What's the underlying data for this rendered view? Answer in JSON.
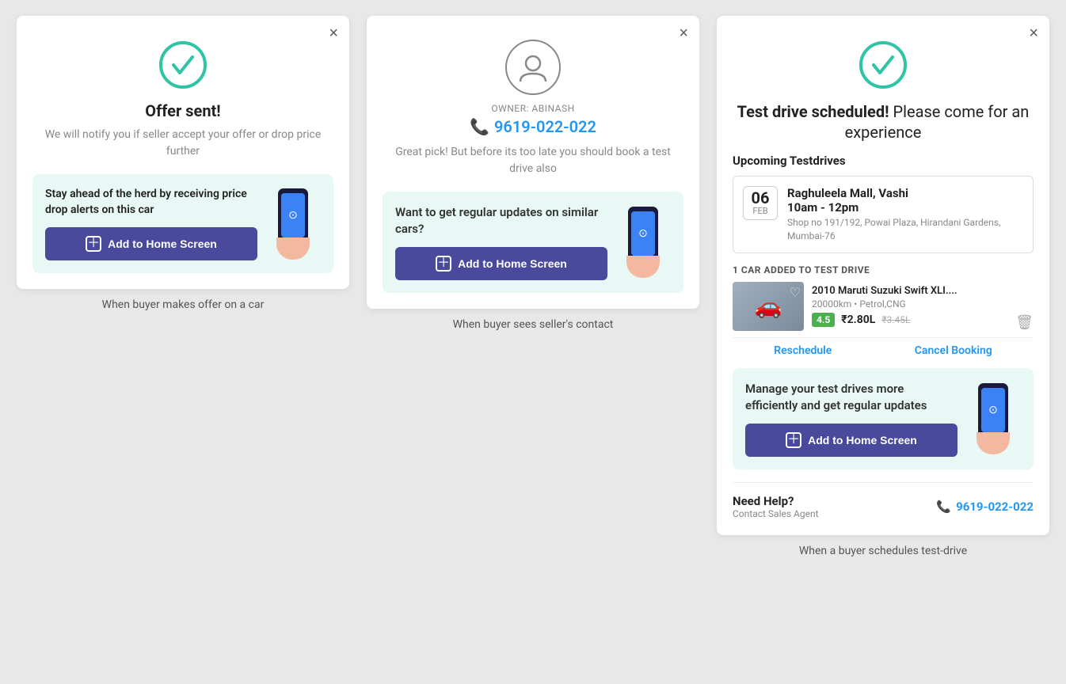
{
  "panel1": {
    "close": "×",
    "title_bold": "Offer sent!",
    "subtitle": "We will notify you if seller accept your offer or drop price further",
    "banner_text": "Stay ahead of the herd by receiving price drop alerts on this car",
    "btn_label": "Add to Home Screen",
    "caption": "When buyer makes offer on a car"
  },
  "panel2": {
    "close": "×",
    "owner_label": "OWNER: ABINASH",
    "owner_phone": "9619-022-022",
    "pick_text": "Great pick! But before its too late you should book a test drive also",
    "banner_text": "Want to get regular updates on similar cars?",
    "btn_label": "Add to Home Screen",
    "caption": "When buyer sees seller's contact"
  },
  "panel3": {
    "close": "×",
    "title_bold": "Test drive scheduled!",
    "title_normal": " Please come for an experience",
    "upcoming_label": "Upcoming Testdrives",
    "date_num": "06",
    "date_month": "FEB",
    "venue_name": "Raghuleela Mall, Vashi",
    "time": "10am - 12pm",
    "address": "Shop no 191/192, Powai Plaza, Hirandani Gardens, Mumbai-76",
    "car_added_label": "1 CAR ADDED TO TEST DRIVE",
    "car_name": "2010 Maruti Suzuki Swift XLI....",
    "car_meta": "20000km • Petrol,CNG",
    "rating": "4.5",
    "price_current": "₹2.80L",
    "price_old": "₹3.45L",
    "reschedule": "Reschedule",
    "cancel": "Cancel Booking",
    "banner_text": "Manage your test drives more efficiently and get regular updates",
    "btn_label": "Add to Home Screen",
    "help_title": "Need Help?",
    "help_sub": "Contact Sales Agent",
    "help_phone": "9619-022-022",
    "caption": "When a buyer schedules test-drive"
  }
}
